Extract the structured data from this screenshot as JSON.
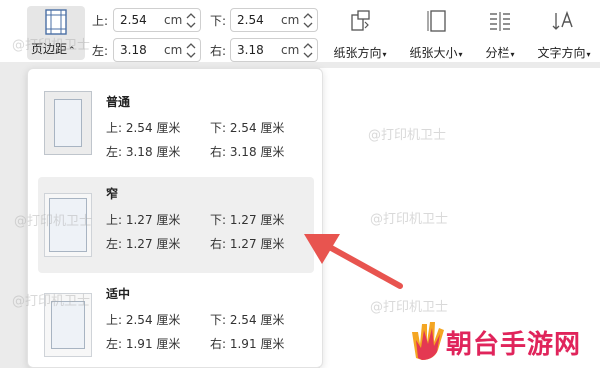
{
  "toolbar": {
    "margins_label": "页边距",
    "top": {
      "label": "上:",
      "value": "2.54",
      "unit": "cm"
    },
    "bottom": {
      "label": "下:",
      "value": "2.54",
      "unit": "cm"
    },
    "left": {
      "label": "左:",
      "value": "3.18",
      "unit": "cm"
    },
    "right": {
      "label": "右:",
      "value": "3.18",
      "unit": "cm"
    },
    "orientation_label": "纸张方向",
    "size_label": "纸张大小",
    "columns_label": "分栏",
    "text_direction_label": "文字方向"
  },
  "presets": [
    {
      "name": "普通",
      "top": "上: 2.54 厘米",
      "bottom": "下: 2.54 厘米",
      "left": "左: 3.18 厘米",
      "right": "右: 3.18 厘米"
    },
    {
      "name": "窄",
      "top": "上: 1.27 厘米",
      "bottom": "下: 1.27 厘米",
      "left": "左: 1.27 厘米",
      "right": "右: 1.27 厘米"
    },
    {
      "name": "适中",
      "top": "上: 2.54 厘米",
      "bottom": "下: 2.54 厘米",
      "left": "左: 1.91 厘米",
      "right": "右: 1.91 厘米"
    }
  ],
  "watermark": "@打印机卫士",
  "brand": {
    "text": "朝台手游网",
    "color": "#e0245b"
  },
  "colors": {
    "arrow": "#e8544f",
    "accent": "#2b579a"
  }
}
